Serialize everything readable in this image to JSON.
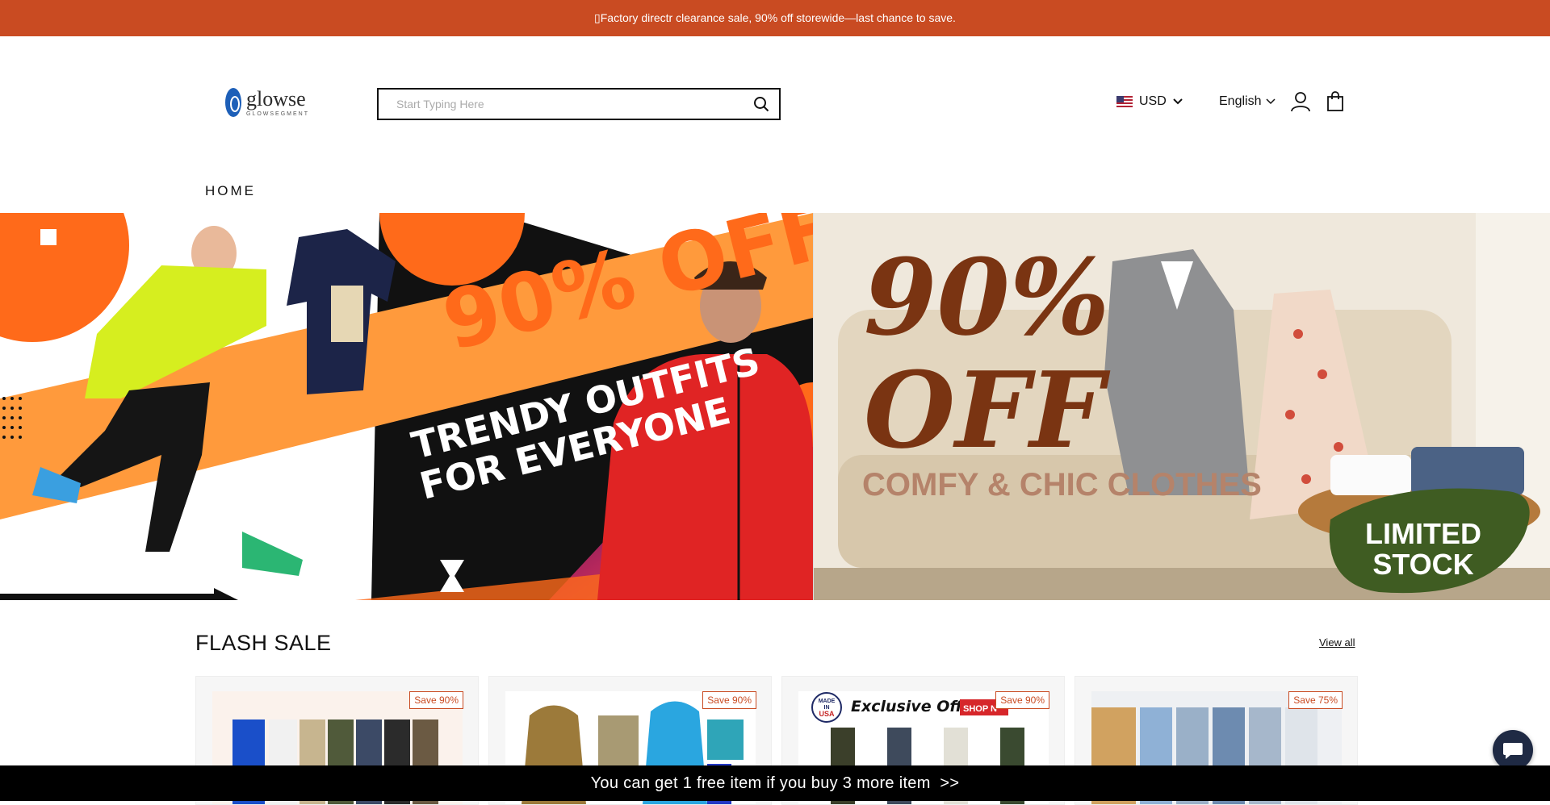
{
  "announcement": {
    "text": "▯Factory directr clearance sale, 90% off storewide—last chance to save."
  },
  "header": {
    "logo_name": "glowse",
    "logo_sub": "GLOWSEGMENT",
    "search_placeholder": "Start Typing Here",
    "currency": "USD",
    "language": "English",
    "icons": [
      "search-icon",
      "user-icon",
      "shopping-bag-icon",
      "chevron-down-icon",
      "us-flag-icon"
    ]
  },
  "nav": {
    "items": [
      "HOME"
    ]
  },
  "hero": {
    "slide1": {
      "headline": "90% OFF",
      "line1": "TRENDY OUTFITS",
      "line2": "FOR EVERYONE"
    },
    "slide2": {
      "headline1": "90%",
      "headline2": "OFF",
      "subline": "COMFY & CHIC CLOTHES",
      "badge1": "LIMITED",
      "badge2": "STOCK"
    }
  },
  "flash_sale": {
    "title": "FLASH SALE",
    "view_all": "View all",
    "products": [
      {
        "save": "Save 90%"
      },
      {
        "save": "Save 90%"
      },
      {
        "save": "Save 90%",
        "banner": "Exclusive Offer",
        "banner_tag": "SHOP N",
        "seal_top": "MADE",
        "seal_mid": "IN",
        "seal_bottom": "USA"
      },
      {
        "save": "Save 75%"
      }
    ]
  },
  "bottom_bar": {
    "text": "You can get 1 free item if you buy 3 more item  >>"
  },
  "colors": {
    "accent": "#c94b22",
    "chat_bg": "#1f2a44"
  }
}
